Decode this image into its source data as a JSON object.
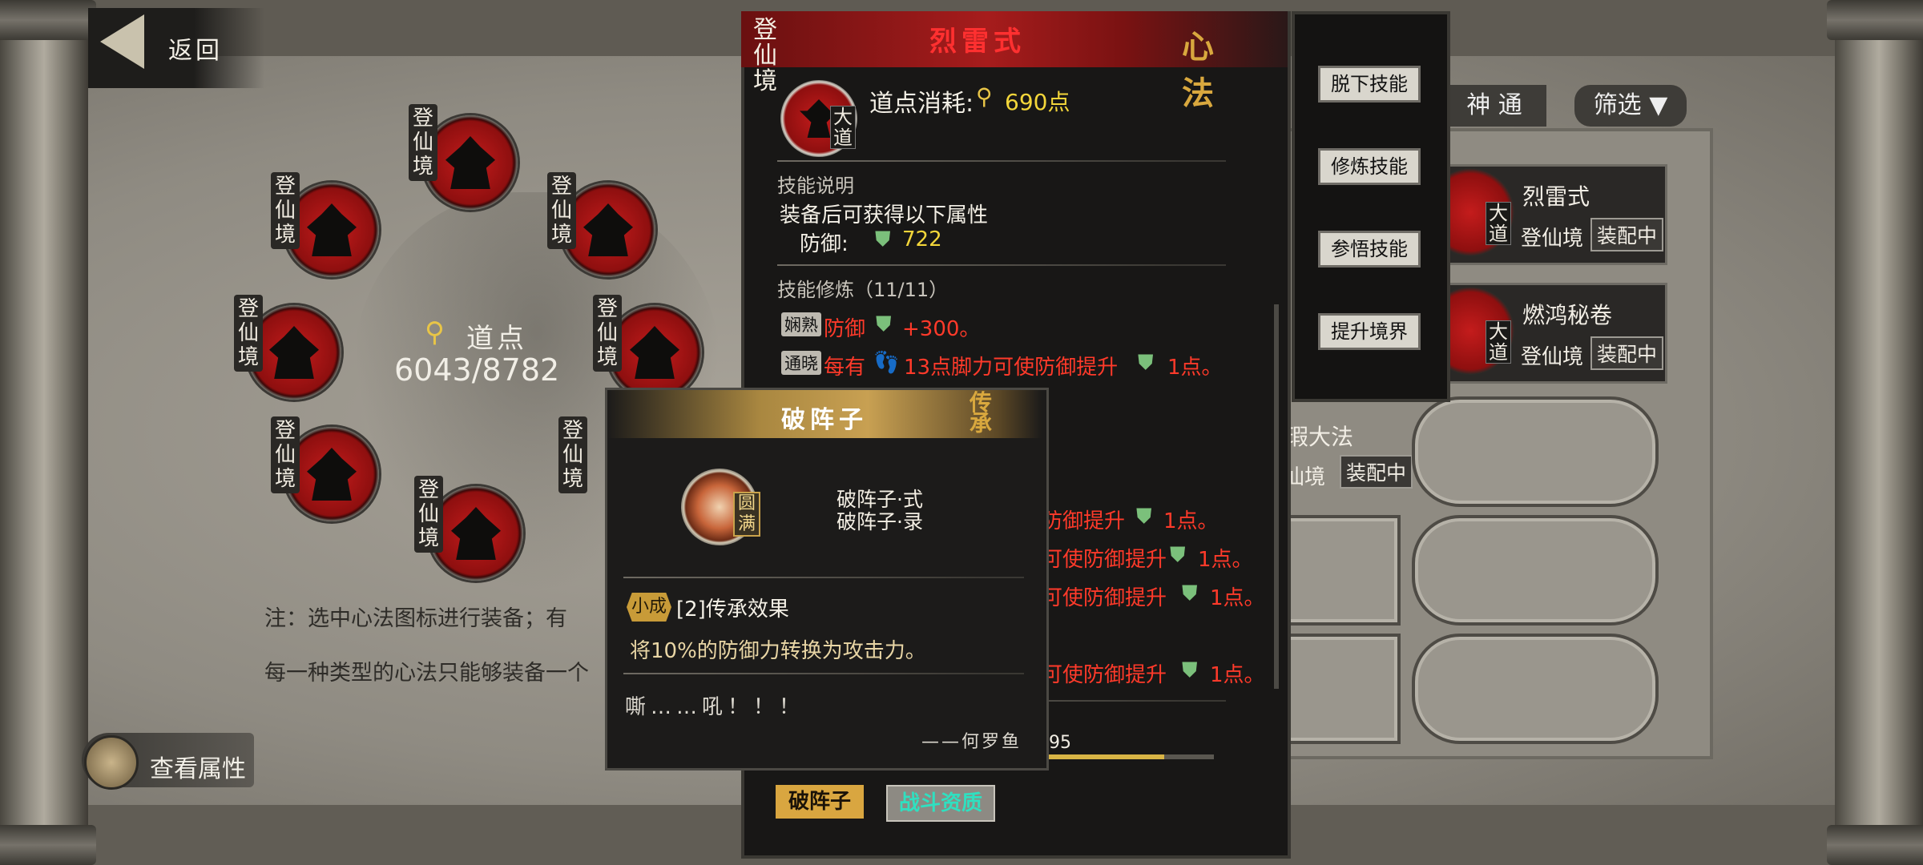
{
  "back": {
    "label": "返回"
  },
  "ring": {
    "points_label": "道点",
    "points_value": "6043/8782",
    "node_realm": "登仙境",
    "notes": [
      "注：选中心法图标进行装备；有",
      "每一种类型的心法只能够装备一个"
    ],
    "view_attrs_label": "查看属性"
  },
  "filter": {
    "tab_label": "神 通",
    "filter_label": "筛选 ▼"
  },
  "list": {
    "entries": [
      {
        "name": "烈雷式",
        "realm": "登仙境",
        "tag": "大道",
        "status": "装配中"
      },
      {
        "name": "燃鸿秘卷",
        "realm": "登仙境",
        "tag": "大道",
        "status": "装配中"
      },
      {
        "name": "瑕大法",
        "realm": "仙境",
        "status": "装配中"
      }
    ]
  },
  "detail": {
    "title": "烈雷式",
    "mark": "心法",
    "realm": "登仙境",
    "tag": "大道",
    "cost_label": "道点消耗:",
    "cost_value": "690点",
    "desc_title": "技能说明",
    "desc_text": "装备后可获得以下属性",
    "defense_label": "防御:",
    "defense_value": "722",
    "train_title": "技能修炼（11/11）",
    "train_lines": [
      {
        "badge": "娴熟",
        "text": "防御",
        "value": "+300。"
      },
      {
        "badge": "通晓",
        "text": "每有",
        "value": "13点脚力可使防御提升",
        "tail": "1点。"
      }
    ],
    "hidden_lines": [
      "防御提升",
      "可使防御提升",
      "可使防御提升",
      "可使防御提升"
    ],
    "hidden_tail": "1点。",
    "progress_text": "695",
    "progress_fraction": 0.84,
    "tag_poszhen": "破阵子",
    "tag_zhandou": "战斗资质"
  },
  "actions": [
    "脱下技能",
    "修炼技能",
    "参悟技能",
    "提升境界"
  ],
  "popup": {
    "title": "破阵子",
    "mark": "传承",
    "badge": "圆满",
    "parts": [
      "破阵子·式",
      "破阵子·录"
    ],
    "level_badge": "小成",
    "effect_title": "[2]传承效果",
    "effect_text": "将10%的防御力转换为攻击力。",
    "quote": "嘶……吼！！！",
    "author": "——何罗鱼"
  }
}
